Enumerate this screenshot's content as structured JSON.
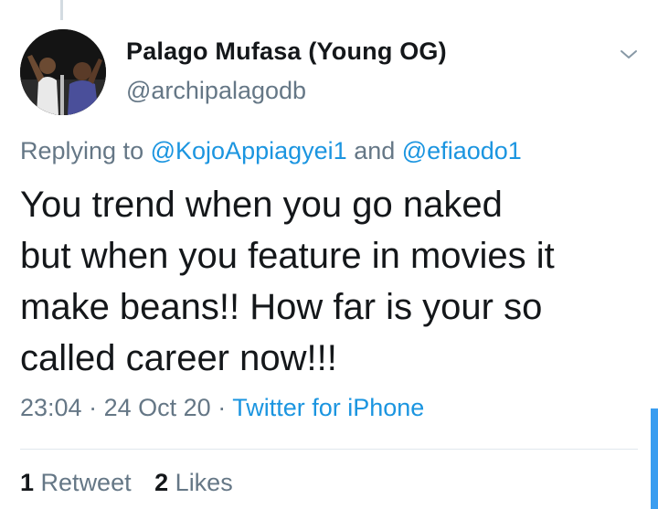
{
  "tweet": {
    "author": {
      "display_name": "Palago Mufasa (Young OG)",
      "handle": "@archipalagodb"
    },
    "replying": {
      "prefix": "Replying to",
      "mention1": "@KojoAppiagyei1",
      "joiner": "and",
      "mention2": "@efiaodo1"
    },
    "text_lines": [
      "You trend when you go naked",
      "but when you feature in movies it",
      "make beans!! How far is your so",
      "called career now!!!"
    ],
    "meta": {
      "time": "23:04",
      "separator": "·",
      "date": "24 Oct 20",
      "source": "Twitter for iPhone"
    },
    "stats": {
      "retweets_count": "1",
      "retweets_label": "Retweet",
      "likes_count": "2",
      "likes_label": "Likes"
    }
  },
  "colors": {
    "accent": "#1b95e0",
    "text_primary": "#14171a",
    "text_secondary": "#657786",
    "divider": "#e1e8ed"
  },
  "icons": {
    "menu": "chevron-down-icon",
    "avatar": "avatar"
  }
}
